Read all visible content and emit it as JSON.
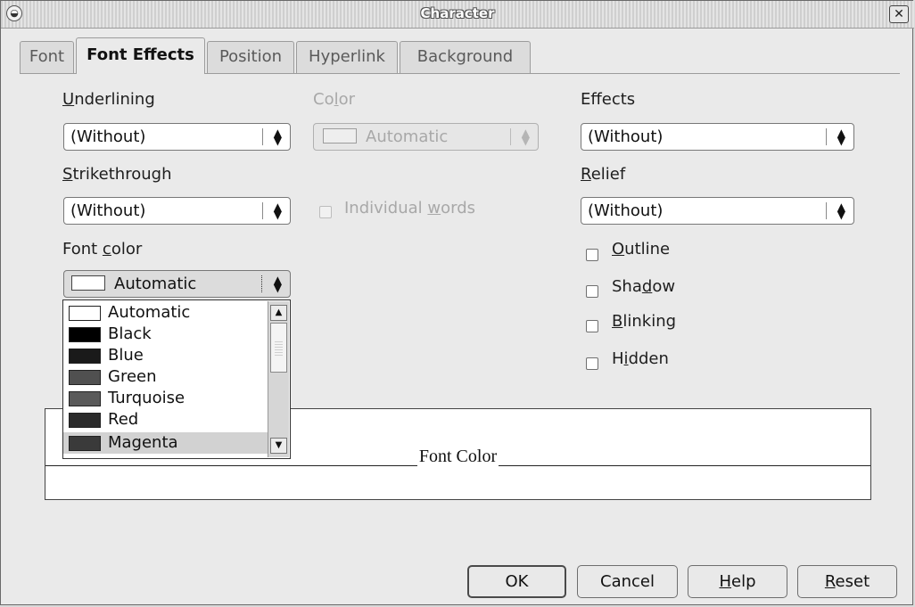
{
  "window": {
    "title": "Character",
    "close_glyph": "✕"
  },
  "tabs": [
    {
      "label": "Font",
      "active": false
    },
    {
      "label": "Font Effects",
      "active": true
    },
    {
      "label": "Position",
      "active": false
    },
    {
      "label": "Hyperlink",
      "active": false
    },
    {
      "label": "Background",
      "active": false
    }
  ],
  "underlining": {
    "mnemonic": "U",
    "rest": "nderlining",
    "value": "(Without)"
  },
  "color": {
    "pre": "Co",
    "mnemonic": "l",
    "post": "or",
    "value": "Automatic"
  },
  "effects": {
    "label": "Effects",
    "value": "(Without)"
  },
  "strikethrough": {
    "mnemonic": "S",
    "rest": "trikethrough",
    "value": "(Without)"
  },
  "individual_words": {
    "pre": "Individual ",
    "mnemonic": "w",
    "post": "ords"
  },
  "relief": {
    "mnemonic": "R",
    "rest": "elief",
    "value": "(Without)"
  },
  "font_color": {
    "pre": "Font ",
    "mnemonic": "c",
    "post": "olor",
    "value": "Automatic",
    "options": [
      {
        "label": "Automatic",
        "swatch": "#ffffff"
      },
      {
        "label": "Black",
        "swatch": "#000000"
      },
      {
        "label": "Blue",
        "swatch": "#1a1a1a"
      },
      {
        "label": "Green",
        "swatch": "#505050"
      },
      {
        "label": "Turquoise",
        "swatch": "#5a5a5a"
      },
      {
        "label": "Red",
        "swatch": "#2b2b2b"
      },
      {
        "label": "Magenta",
        "swatch": "#3a3a3a"
      }
    ],
    "highlighted_option": "Magenta"
  },
  "checkboxes": {
    "outline": {
      "mnemonic": "O",
      "rest": "utline"
    },
    "shadow": {
      "pre": "Sha",
      "mnemonic": "d",
      "post": "ow"
    },
    "blinking": {
      "mnemonic": "B",
      "rest": "linking"
    },
    "hidden": {
      "pre": "H",
      "mnemonic": "i",
      "post": "dden"
    }
  },
  "preview": {
    "text": "Font Color"
  },
  "buttons": {
    "ok": "OK",
    "cancel": "Cancel",
    "help": {
      "mnemonic": "H",
      "rest": "elp"
    },
    "reset": {
      "mnemonic": "R",
      "rest": "eset"
    }
  },
  "icons": {
    "spin_arrows": "⇕",
    "scroll_up": "▲",
    "scroll_down": "▼"
  }
}
